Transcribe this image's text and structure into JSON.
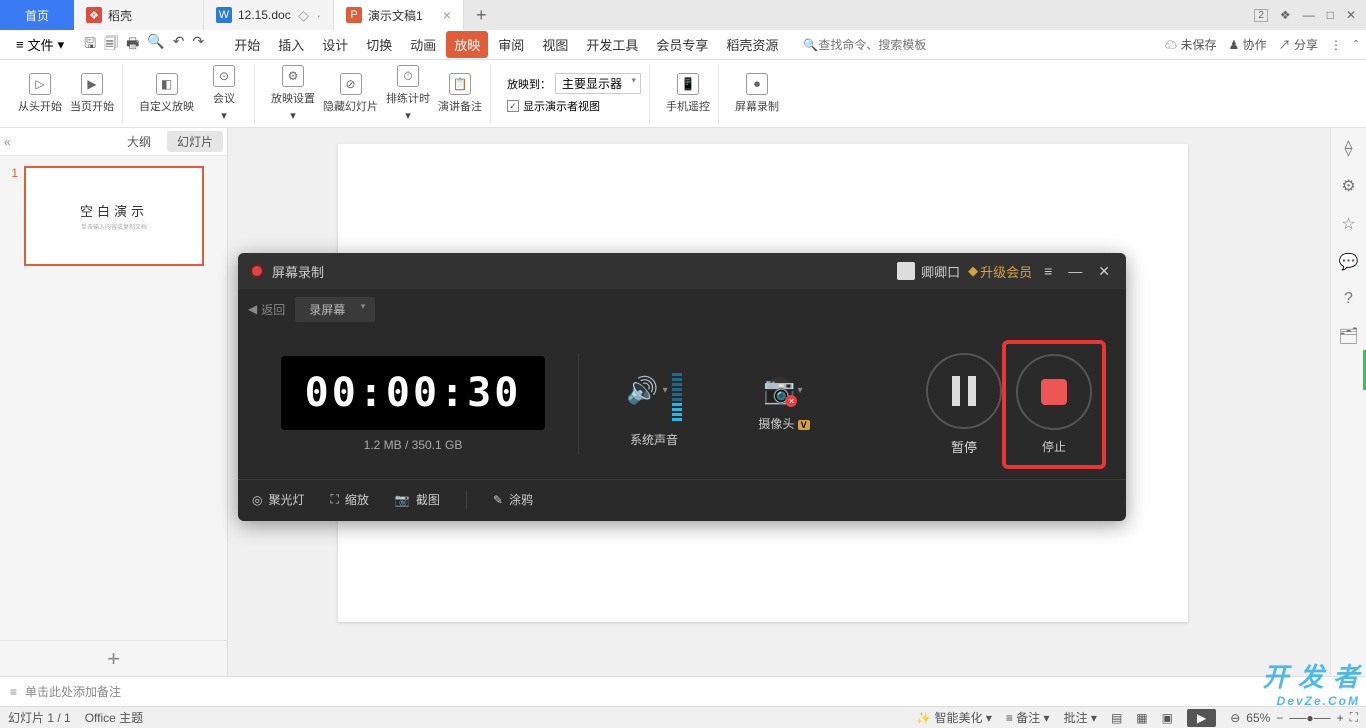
{
  "tabs": {
    "home": "首页",
    "docA": "稻壳",
    "docB": "12.15.doc",
    "docC": "演示文稿1",
    "badge": "2"
  },
  "menubar": {
    "file": "文件",
    "items": [
      "开始",
      "插入",
      "设计",
      "切换",
      "动画",
      "放映",
      "审阅",
      "视图",
      "开发工具",
      "会员专享",
      "稻壳资源"
    ],
    "active_index": 5,
    "search_placeholder": "查找命令、搜索模板",
    "right": {
      "unsaved": "未保存",
      "collab": "协作",
      "share": "分享"
    }
  },
  "ribbon": {
    "from_start": "从头开始",
    "from_current": "当页开始",
    "custom": "自定义放映",
    "meeting": "会议",
    "settings": "放映设置",
    "hide": "隐藏幻灯片",
    "rehearse": "排练计时",
    "notes": "演讲备注",
    "target_label": "放映到：",
    "target_value": "主要显示器",
    "presenter_view": "显示演示者视图",
    "phone": "手机遥控",
    "record": "屏幕录制"
  },
  "leftpanel": {
    "outline": "大纲",
    "slides": "幻灯片",
    "thumb_title": "空白演示",
    "thumb_sub": "单击输入内容或复制文档",
    "slide_num": "1"
  },
  "notes": {
    "placeholder": "单击此处添加备注"
  },
  "status": {
    "slide_pos": "幻灯片 1 / 1",
    "theme": "Office 主题",
    "beautify": "智能美化",
    "notes_btn": "备注",
    "comments": "批注",
    "zoom": "65%"
  },
  "recorder": {
    "title": "屏幕录制",
    "user": "卿卿口",
    "upgrade": "升级会员",
    "back": "返回",
    "mode": "录屏幕",
    "timer": "00:00:30",
    "size": "1.2 MB / 350.1 GB",
    "audio": "系统声音",
    "camera": "摄像头",
    "pause": "暂停",
    "stop": "停止",
    "tools": {
      "spotlight": "聚光灯",
      "zoom": "缩放",
      "shot": "截图",
      "annotate": "涂鸦"
    }
  },
  "watermark": {
    "big": "开 发 者",
    "small": "DevZe.CoM"
  }
}
